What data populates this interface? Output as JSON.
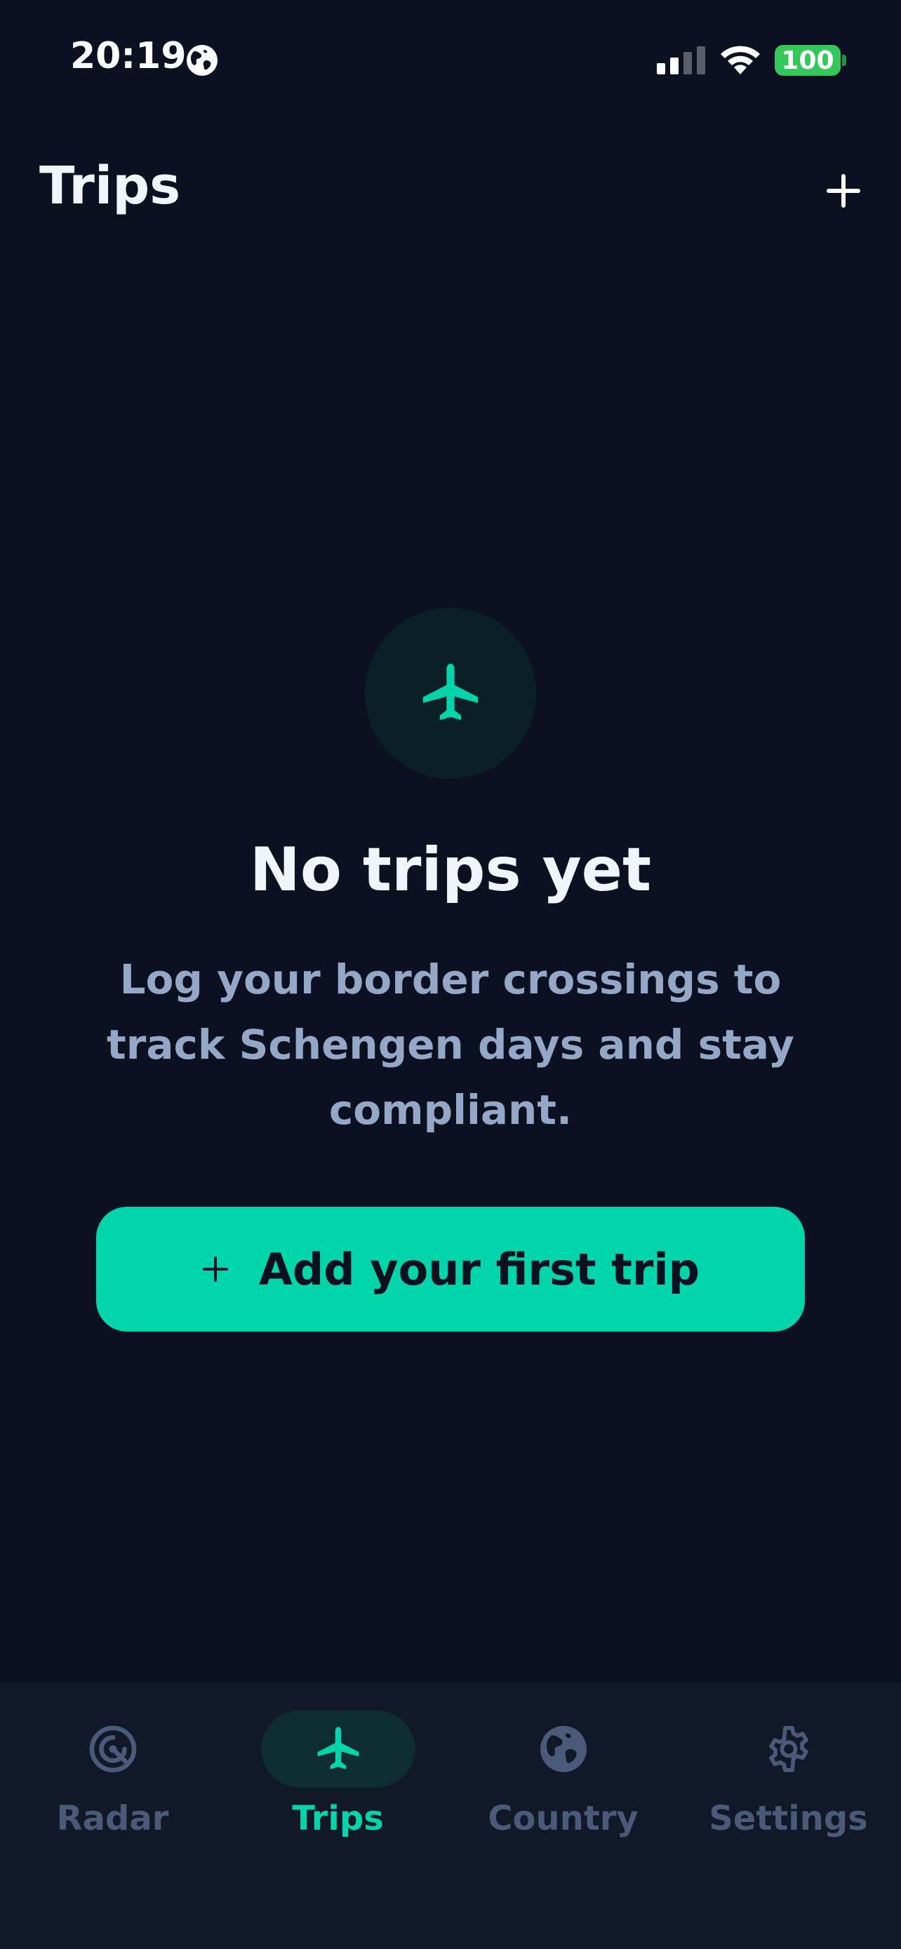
{
  "status_bar": {
    "time": "20:19",
    "battery": "100",
    "globe_icon": "globe-icon",
    "signal_icon": "cellular-signal-icon",
    "wifi_icon": "wifi-icon"
  },
  "header": {
    "title": "Trips",
    "add_icon": "plus-icon"
  },
  "empty_state": {
    "icon": "airplane-icon",
    "title": "No trips yet",
    "description": "Log your border crossings to track Schengen days and stay compliant.",
    "button_label": "Add your first trip",
    "button_icon": "plus-icon"
  },
  "tabs": [
    {
      "label": "Radar",
      "icon": "radar-icon",
      "active": false
    },
    {
      "label": "Trips",
      "icon": "airplane-icon",
      "active": true
    },
    {
      "label": "Country",
      "icon": "globe-icon",
      "active": false
    },
    {
      "label": "Settings",
      "icon": "gear-icon",
      "active": false
    }
  ],
  "colors": {
    "background": "#0b1120",
    "accent": "#00d4aa",
    "tab_bar": "#111827",
    "muted_text": "#95a7c7",
    "inactive_tab": "#4a5a78",
    "battery": "#34c759"
  }
}
